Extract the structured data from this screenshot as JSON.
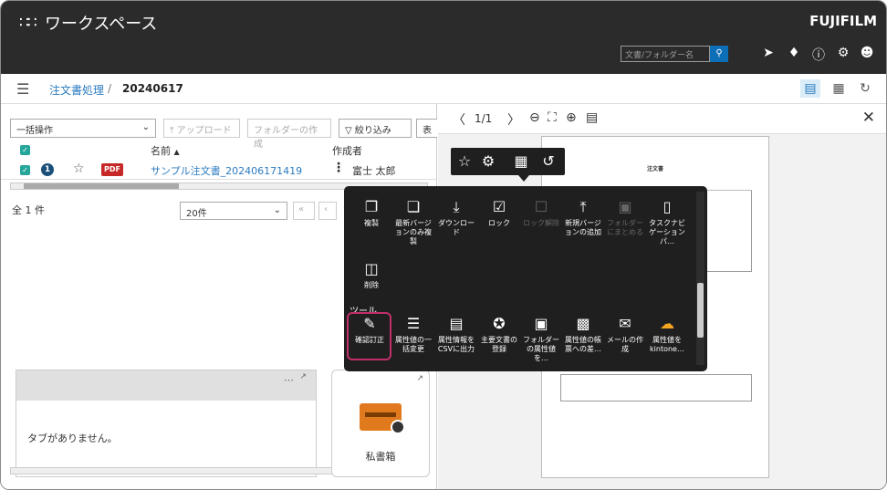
{
  "header": {
    "apps_glyph": "∷∷",
    "title": "ワークスペース",
    "brand": "FUJIFILM",
    "search_placeholder": "文書/フォルダー名",
    "search_icon": "search-icon",
    "icons": [
      "send-icon",
      "bell-icon",
      "help-icon",
      "gear-icon",
      "user-icon"
    ]
  },
  "breadcrumb": {
    "root": "注文書処理",
    "separator": "/",
    "current": "20240617"
  },
  "left": {
    "bulk": "一括操作",
    "upload": "アップロード",
    "new_folder": "フォルダーの作成",
    "filter": "絞り込み",
    "display": "表示",
    "col_name": "名前",
    "col_creator": "作成者",
    "row": {
      "badge": "1",
      "type": "PDF",
      "name": "サンプル注文書_202406171419",
      "creator": "富士 太郎"
    },
    "count": "全 1 件",
    "per_page": "20件",
    "no_tab": "タブがありません。",
    "box_label": "私書箱"
  },
  "viewer": {
    "page": "1/1",
    "doc_title": "注文書"
  },
  "popup": {
    "row1": [
      {
        "icon": "copy-icon",
        "label": "複製",
        "enabled": true
      },
      {
        "icon": "copy-latest-icon",
        "label": "最新バージョンのみ複製",
        "enabled": true
      },
      {
        "icon": "download-icon",
        "label": "ダウンロード",
        "enabled": true
      },
      {
        "icon": "lock-icon",
        "label": "ロック",
        "enabled": true
      },
      {
        "icon": "unlock-icon",
        "label": "ロック解除",
        "enabled": false
      },
      {
        "icon": "new-version-icon",
        "label": "新規バージョンの追加",
        "enabled": true
      },
      {
        "icon": "folder-merge-icon",
        "label": "フォルダーにまとめる",
        "enabled": false
      },
      {
        "icon": "task-navigation-icon",
        "label": "タスクナビゲーションパ…",
        "enabled": true
      }
    ],
    "delete": {
      "icon": "trash-icon",
      "label": "削除"
    },
    "section": "ツール",
    "tools": [
      {
        "icon": "confirm-correct-icon",
        "label": "確認訂正"
      },
      {
        "icon": "attr-bulk-icon",
        "label": "属性値の一括変更"
      },
      {
        "icon": "csv-icon",
        "label": "属性情報をCSVに出力"
      },
      {
        "icon": "main-doc-icon",
        "label": "主要文書の登録"
      },
      {
        "icon": "folder-attr-icon",
        "label": "フォルダーの属性値を…"
      },
      {
        "icon": "ledger-icon",
        "label": "属性値の帳票への差…"
      },
      {
        "icon": "mail-icon",
        "label": "メールの作成"
      },
      {
        "icon": "kintone-icon",
        "label": "属性値をkintone…"
      }
    ]
  }
}
